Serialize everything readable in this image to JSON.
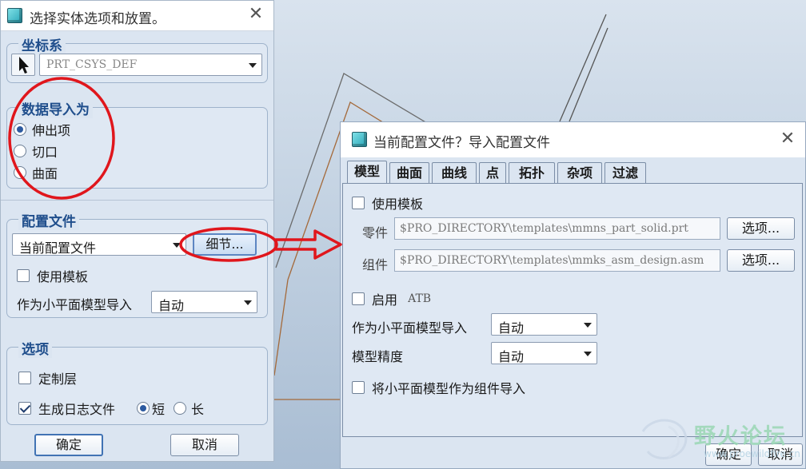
{
  "dialog_left": {
    "title": "选择实体选项和放置。",
    "coord_group": {
      "legend": "坐标系",
      "value": "PRT_CSYS_DEF"
    },
    "import_group": {
      "legend": "数据导入为",
      "options": [
        "伸出项",
        "切口",
        "曲面"
      ],
      "selected": 0
    },
    "config_group": {
      "legend": "配置文件",
      "profile_value": "当前配置文件",
      "details_label": "细节...",
      "use_template_label": "使用模板",
      "facet_label": "作为小平面模型导入",
      "facet_value": "自动"
    },
    "options_group": {
      "legend": "选项",
      "custom_layers_label": "定制层",
      "log_file_label": "生成日志文件",
      "short_label": "短",
      "long_label": "长"
    },
    "ok_label": "确定",
    "cancel_label": "取消"
  },
  "dialog_right": {
    "title": "当前配置文件？导入配置文件",
    "tabs": [
      "模型",
      "曲面",
      "曲线",
      "点",
      "拓扑",
      "杂项",
      "过滤"
    ],
    "active_tab": 0,
    "use_template_label": "使用模板",
    "part_label": "零件",
    "part_path": "$PRO_DIRECTORY\\templates\\mmns_part_solid.prt",
    "assembly_label": "组件",
    "assembly_path": "$PRO_DIRECTORY\\templates\\mmks_asm_design.asm",
    "options_button": "选项...",
    "enable_label": "启用",
    "atb_label": "ATB",
    "facet_label": "作为小平面模型导入",
    "facet_value": "自动",
    "accuracy_label": "模型精度",
    "accuracy_value": "自动",
    "facet_as_asm_label": "将小平面模型作为组件导入",
    "ok_label": "确定",
    "cancel_label": "取消"
  },
  "watermark": {
    "text": "野火论坛",
    "sub": "www.proewildfire.cn"
  },
  "colors": {
    "annotation": "#e0161c",
    "legend": "#1f4e8c",
    "dialog_bg": "#dbe5f1"
  }
}
